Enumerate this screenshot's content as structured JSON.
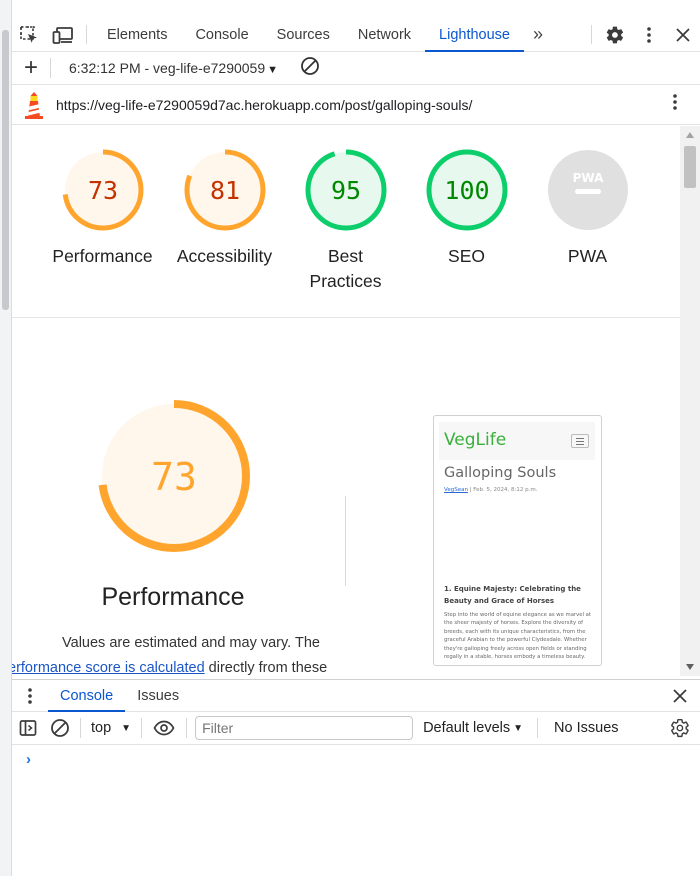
{
  "devtools": {
    "tabs": [
      "Elements",
      "Console",
      "Sources",
      "Network",
      "Lighthouse"
    ],
    "active_tab": "Lighthouse",
    "more_tabs_glyph": "»",
    "icons": [
      "inspect-element-icon",
      "device-toolbar-icon",
      "settings-gear-icon",
      "kebab-menu-icon",
      "close-icon"
    ]
  },
  "lighthouse_toolbar": {
    "new_report_glyph": "+",
    "report_selector": "6:32:12 PM - veg-life-e7290059",
    "dropdown_glyph": "▼"
  },
  "url_bar": {
    "url": "https://veg-life-e7290059d7ac.herokuapp.com/post/galloping-souls/"
  },
  "scores": [
    {
      "label": "Performance",
      "value": "73",
      "status": "average"
    },
    {
      "label": "Accessibility",
      "value": "81",
      "status": "average"
    },
    {
      "label": "Best Practices",
      "value": "95",
      "status": "pass"
    },
    {
      "label": "SEO",
      "value": "100",
      "status": "pass"
    },
    {
      "label": "PWA",
      "value": "",
      "badge": "PWA",
      "status": "na"
    }
  ],
  "colors": {
    "average_arc": "#ffa52e",
    "average_fill": "#fff6ec",
    "average_text": "#c33300",
    "pass_arc": "#0cce6b",
    "pass_fill": "#e7f9ef",
    "pass_text": "#008800",
    "na_fill": "#e0e0e0",
    "link": "#1a56c8",
    "accent": "#0b57d0"
  },
  "performance_detail": {
    "score": "73",
    "title": "Performance",
    "description_line1": "Values are estimated and may vary. The",
    "description_link": "erformance score is calculated",
    "description_rest": " directly from these"
  },
  "page_screenshot": {
    "brand": "VegLife",
    "post_title": "Galloping Souls",
    "author": "VegSean",
    "date": " | Feb. 5, 2024, 8:12 p.m.",
    "heading": "1. Equine Majesty: Celebrating the Beauty and Grace of Horses",
    "body": "Step into the world of equine elegance as we marvel at the sheer majesty of horses. Explore the diversity of breeds, each with its unique characteristics, from the graceful Arabian to the powerful Clydesdale. Whether they're galloping freely across open fields or standing regally in a stable, horses embody a timeless beauty."
  },
  "drawer": {
    "tabs": [
      "Console",
      "Issues"
    ],
    "active_tab": "Console",
    "context": "top",
    "filter_placeholder": "Filter",
    "levels": "Default levels",
    "issues": "No Issues",
    "prompt": "›"
  }
}
